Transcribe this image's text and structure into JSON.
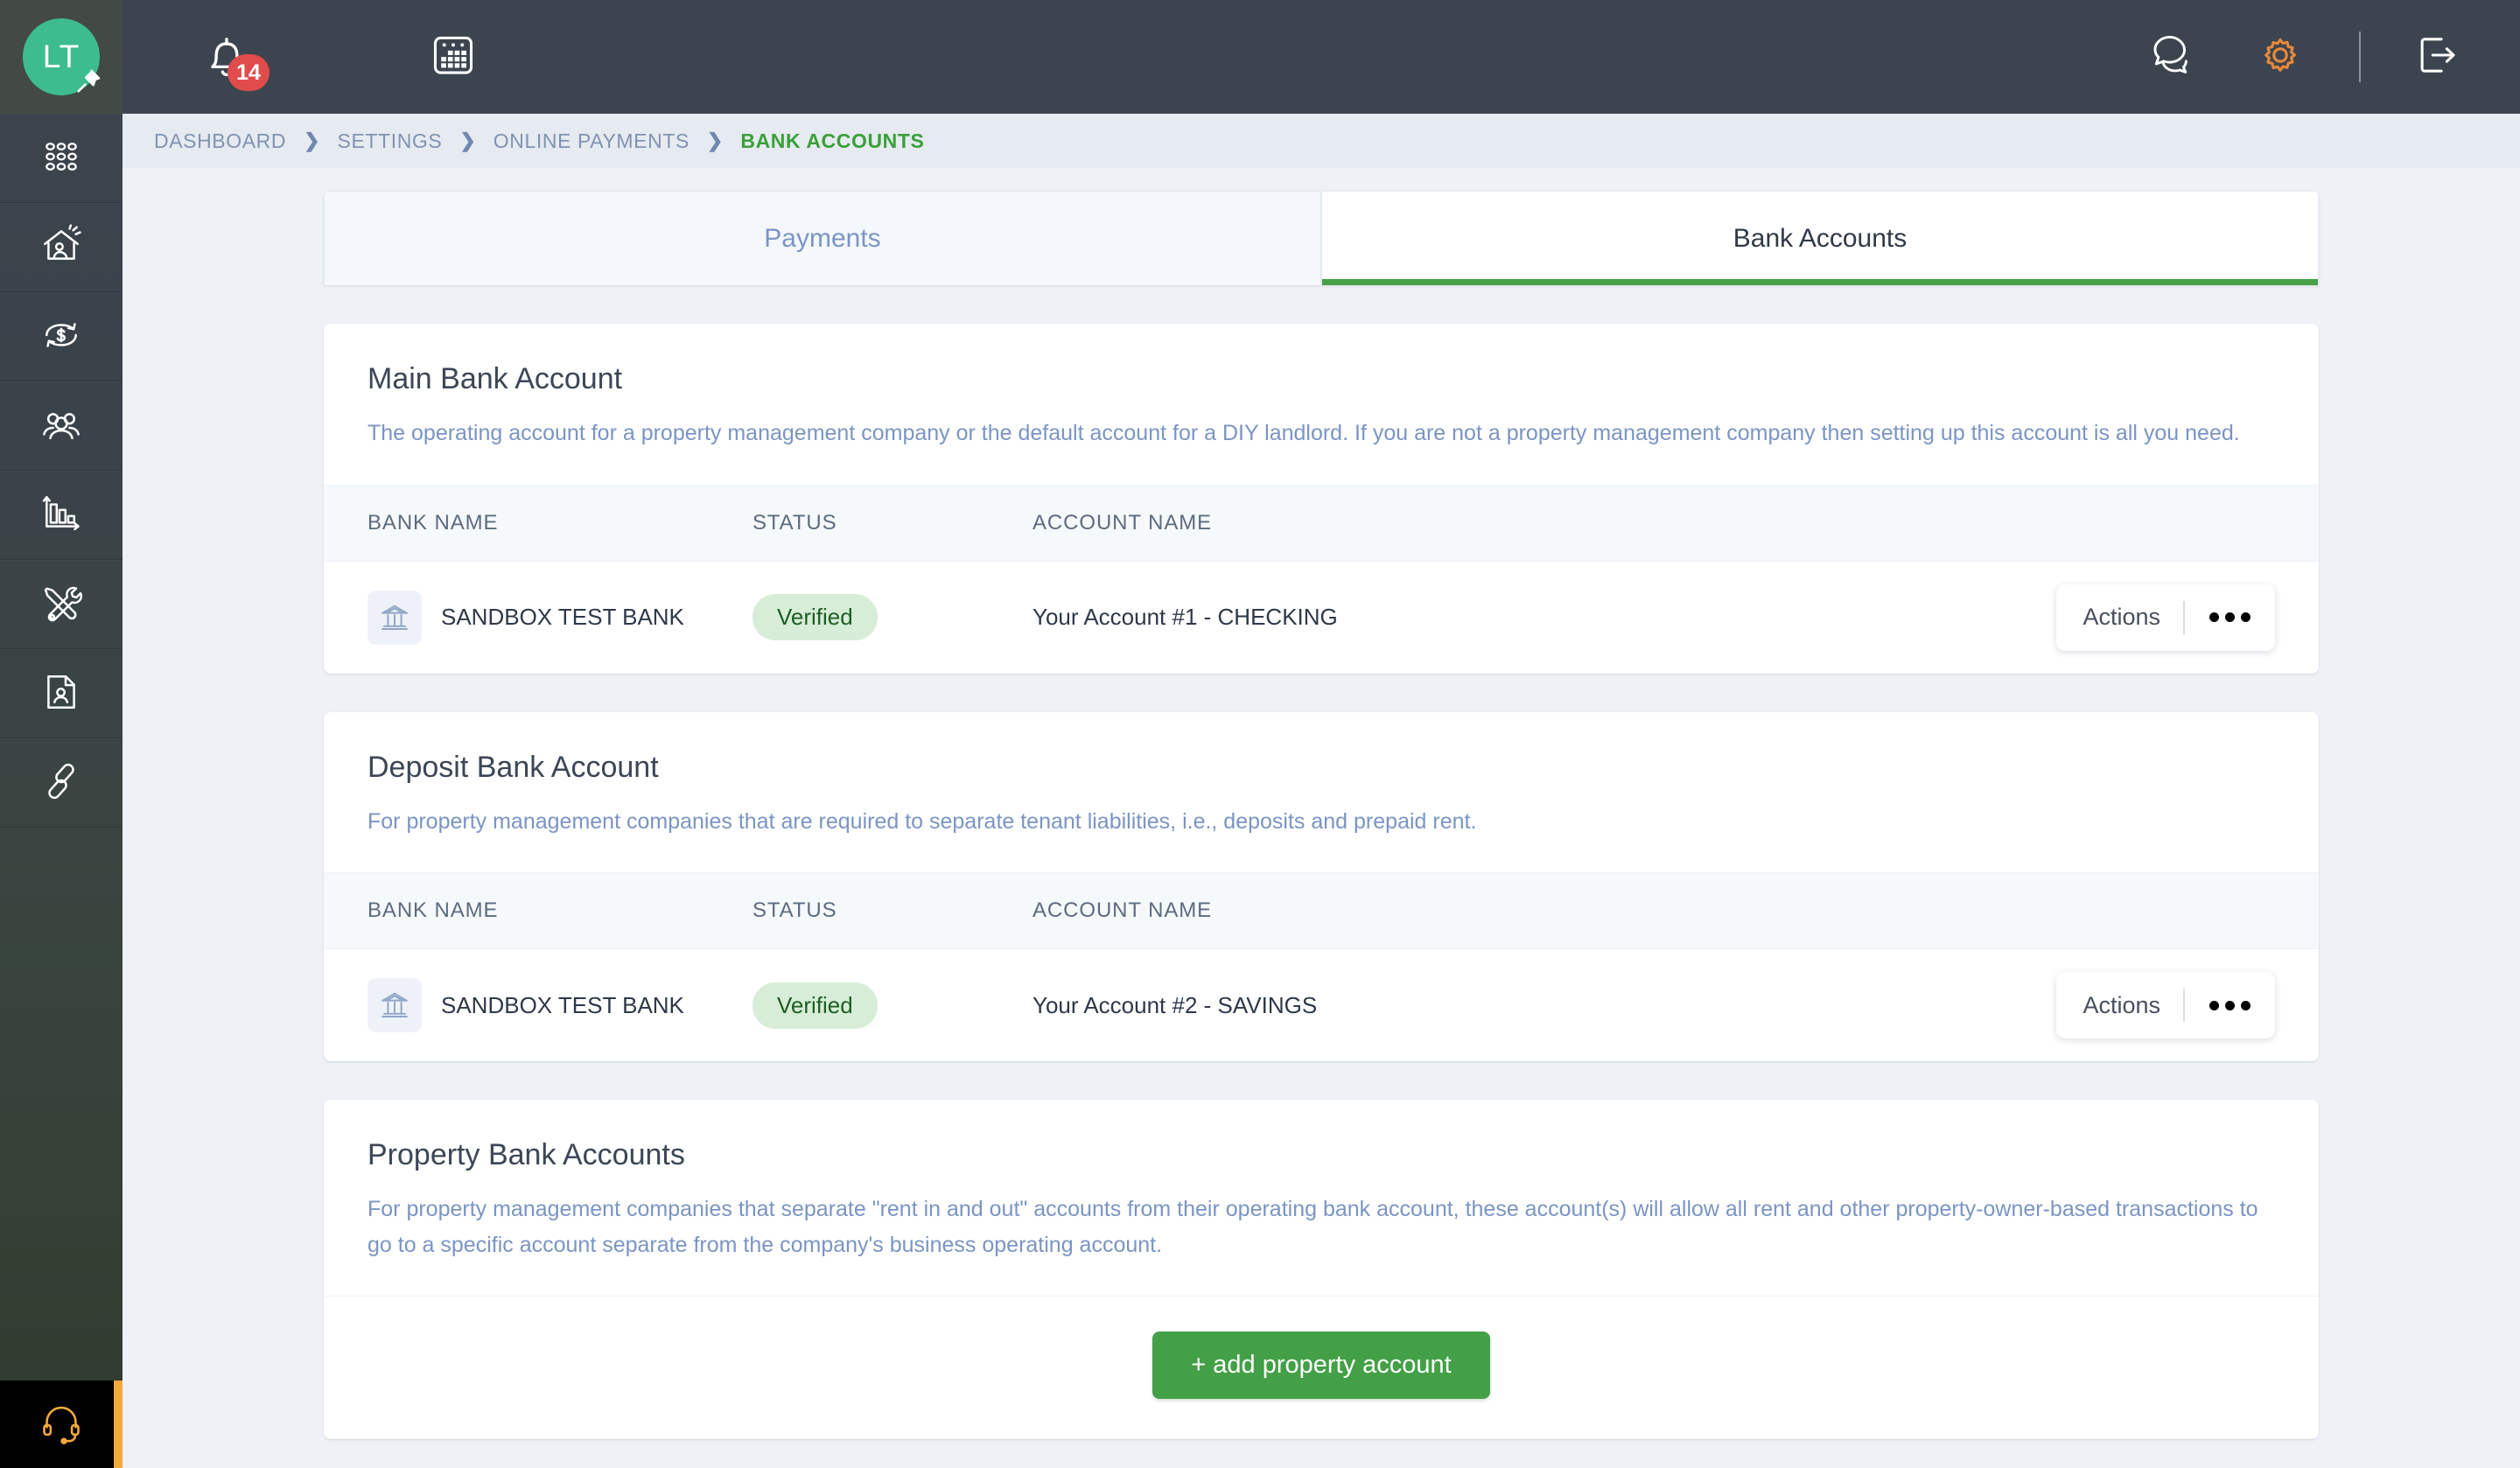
{
  "topbar": {
    "avatar_initials": "LT",
    "pin_icon": "pin-icon",
    "notifications_icon": "bell-icon",
    "notifications_count": "14",
    "calendar_icon": "calendar-icon",
    "chat_icon": "chat-bubbles-icon",
    "settings_icon": "gear-icon",
    "logout_icon": "logout-icon",
    "accent_orange": "#e8883a"
  },
  "rail": {
    "items": [
      {
        "name": "apps-grid-icon"
      },
      {
        "name": "property-house-icon"
      },
      {
        "name": "money-transfer-icon"
      },
      {
        "name": "people-icon"
      },
      {
        "name": "reports-bar-chart-icon"
      },
      {
        "name": "maintenance-tools-icon"
      },
      {
        "name": "tenant-document-icon"
      },
      {
        "name": "link-chain-icon"
      }
    ],
    "support_icon": "headset-icon",
    "support_accent": "#f5a83c"
  },
  "breadcrumb": {
    "items": [
      "DASHBOARD",
      "SETTINGS",
      "ONLINE PAYMENTS",
      "BANK ACCOUNTS"
    ],
    "separator": "❯",
    "active_index": 3,
    "active_color": "#3aa03a"
  },
  "tabs": [
    {
      "label": "Payments",
      "active": false
    },
    {
      "label": "Bank Accounts",
      "active": true
    }
  ],
  "columns": {
    "bank_name": "BANK NAME",
    "status": "STATUS",
    "account_name": "ACCOUNT NAME"
  },
  "actions": {
    "label": "Actions",
    "menu_icon": "ellipsis-icon"
  },
  "cards": [
    {
      "title": "Main Bank Account",
      "description": "The operating account for a property management company or the default account for a DIY landlord. If you are not a property management company then setting up this account is all you need.",
      "rows": [
        {
          "bank_icon": "bank-building-icon",
          "bank_name": "SANDBOX TEST BANK",
          "status": "Verified",
          "account_name": "Your Account #1 - CHECKING"
        }
      ]
    },
    {
      "title": "Deposit Bank Account",
      "description": "For property management companies that are required to separate tenant liabilities, i.e., deposits and prepaid rent.",
      "rows": [
        {
          "bank_icon": "bank-building-icon",
          "bank_name": "SANDBOX TEST BANK",
          "status": "Verified",
          "account_name": "Your Account #2 - SAVINGS"
        }
      ]
    },
    {
      "title": "Property Bank Accounts",
      "description": "For property management companies that separate \"rent in and out\" accounts from their operating bank account, these account(s) will allow all rent and other property-owner-based transactions to go to a specific account separate from the company's business operating account.",
      "footer_button": "+ add property account"
    }
  ],
  "colors": {
    "green": "#43a047",
    "badge_bg": "#d7edd8",
    "badge_text": "#1d5e22",
    "link_blue": "#7b95c4"
  }
}
